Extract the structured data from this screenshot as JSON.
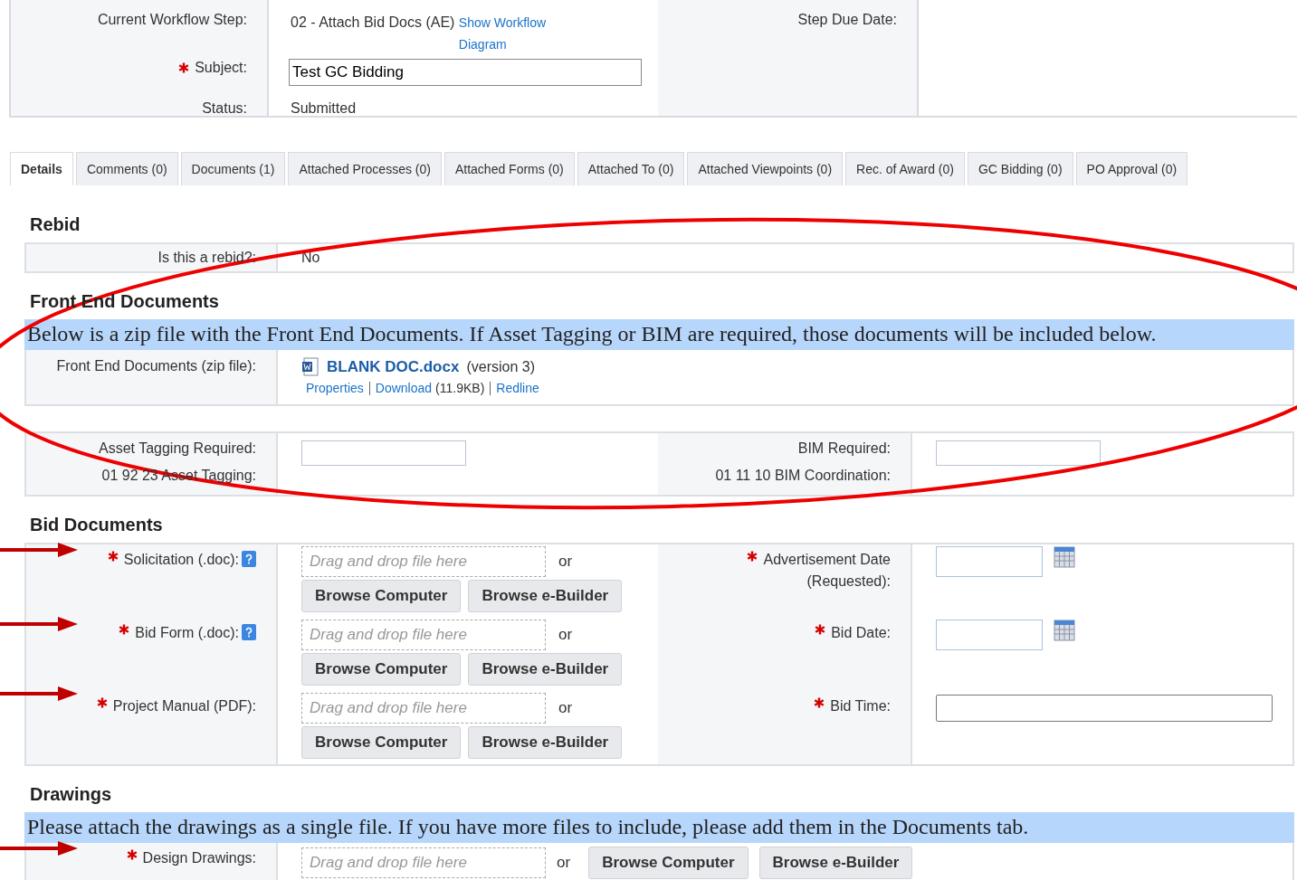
{
  "header": {
    "workflow_step_label": "Current Workflow Step:",
    "workflow_step": "02 - Attach Bid Docs (AE)",
    "workflow_link": "Show Workflow Diagram",
    "subject": {
      "label": "Subject:",
      "required": true,
      "value": "Test GC Bidding"
    },
    "status_label": "Status:",
    "status": "Submitted",
    "due_date_label": "Step Due Date:"
  },
  "tabs": [
    {
      "label": "Details",
      "selected": true
    },
    {
      "label": "Comments (0)",
      "selected": false
    },
    {
      "label": "Documents (1)",
      "selected": false
    },
    {
      "label": "Attached Processes (0)",
      "selected": false
    },
    {
      "label": "Attached Forms (0)",
      "selected": false
    },
    {
      "label": "Attached To (0)",
      "selected": false
    },
    {
      "label": "Attached Viewpoints (0)",
      "selected": false
    },
    {
      "label": "Rec. of Award (0)",
      "selected": false
    },
    {
      "label": "GC Bidding (0)",
      "selected": false
    },
    {
      "label": "PO Approval (0)",
      "selected": false
    }
  ],
  "rebid": {
    "title": "Rebid",
    "label": "Is this a rebid?:",
    "value": "No"
  },
  "front_end": {
    "title": "Front End Documents",
    "banner": "Below is a zip file with the Front End Documents. If Asset Tagging or BIM are required, those documents will be included below.",
    "label": "Front End Documents (zip file):",
    "file_name": "BLANK DOC.docx",
    "version": "(version 3)",
    "links": [
      "Properties",
      "Download",
      "Redline"
    ],
    "size": "(11.9KB)"
  },
  "requirements": {
    "asset_label": "Asset Tagging Required:",
    "asset_field_label": "01 92 23 Asset Tagging:",
    "bim_label": "BIM Required:",
    "bim_field_label": "01 11 10 BIM Coordination:"
  },
  "bid_documents": {
    "title": "Bid Documents",
    "rows": [
      {
        "upload": {
          "label": "Solicitation (.doc):",
          "required": true,
          "help": true,
          "placeholder": "Drag and drop file here",
          "or": "or",
          "buttons": [
            "Browse Computer",
            "Browse e-Builder"
          ]
        },
        "field": {
          "label": "Advertisement Date (Requested):",
          "required": true,
          "kind": "date"
        }
      },
      {
        "upload": {
          "label": "Bid Form (.doc):",
          "required": true,
          "help": true,
          "placeholder": "Drag and drop file here",
          "or": "or",
          "buttons": [
            "Browse Computer",
            "Browse e-Builder"
          ]
        },
        "field": {
          "label": "Bid Date:",
          "required": true,
          "kind": "date"
        }
      },
      {
        "upload": {
          "label": "Project Manual (PDF):",
          "required": true,
          "help": false,
          "placeholder": "Drag and drop file here",
          "or": "or",
          "buttons": [
            "Browse Computer",
            "Browse e-Builder"
          ]
        },
        "field": {
          "label": "Bid Time:",
          "required": true,
          "kind": "text"
        }
      }
    ]
  },
  "drawings": {
    "title": "Drawings",
    "banner": "Please attach the drawings as a single file. If you have more files to include, please add them in the Documents tab.",
    "upload": {
      "label": "Design Drawings:",
      "required": true,
      "placeholder": "Drag and drop file here",
      "or": "or",
      "buttons": [
        "Browse Computer",
        "Browse e-Builder"
      ]
    }
  }
}
